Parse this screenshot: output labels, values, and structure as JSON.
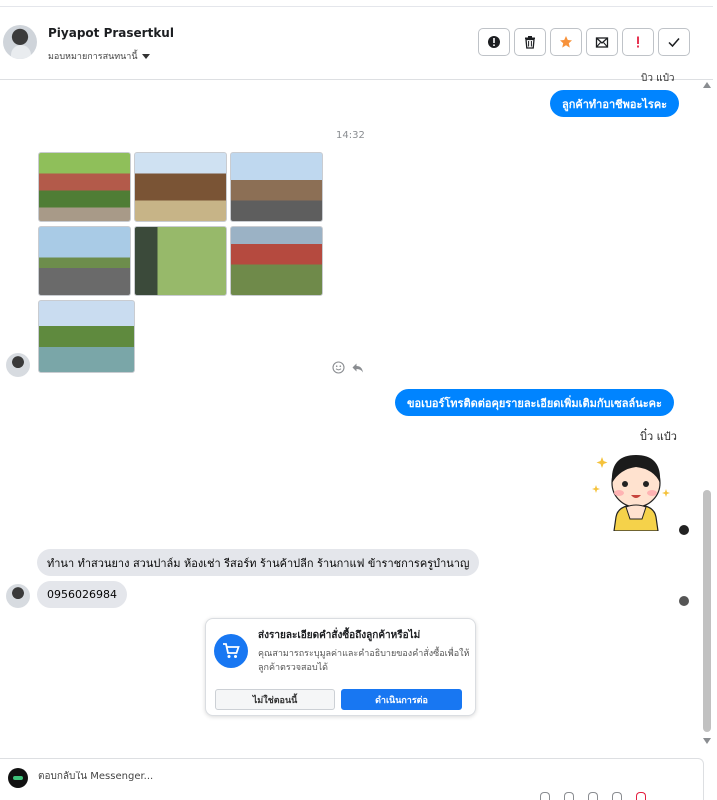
{
  "header": {
    "contact_name": "Piyapot Prasertkul",
    "assign_label": "มอบหมายการสนทนานี้",
    "actions": [
      {
        "icon": "alert-circle-icon",
        "color": "#1c1e21"
      },
      {
        "icon": "trash-icon",
        "color": "#1c1e21"
      },
      {
        "icon": "star-icon",
        "color": "#f7923b"
      },
      {
        "icon": "mark-unread-icon",
        "color": "#1c1e21"
      },
      {
        "icon": "exclamation-icon",
        "color": "#e41e3f"
      },
      {
        "icon": "check-icon",
        "color": "#1c1e21"
      }
    ]
  },
  "messages": {
    "top_sender_cut": "บิว แป๋ว",
    "out_1": "ลูกค้าทำอาชีพอะไรคะ",
    "timestamp": "14:32",
    "photo_count": 7,
    "out_2": "ขอเบอร์โทรติดต่อคุยรายละเอียดเพิ่มเติมกับเซลล์นะคะ",
    "sender_label": "บิ๋ว แป๋ว",
    "in_1": "ทำนา ทำสวนยาง สวนปาล์ม ห้องเช่า รีสอร์ท  ร้านค้าปลีก ร้านกาแฟ  ข้าราชการครูบำนาญ",
    "in_2": "0956026984"
  },
  "order_prompt": {
    "title": "ส่งรายละเอียดคำสั่งซื้อถึงลูกค้าหรือไม่",
    "description": "คุณสามารถระบุมูลค่าและคำอธิบายของคำสั่งซื้อเพื่อให้ลูกค้าตรวจสอบได้",
    "decline_label": "ไม่ใช่ตอนนี้",
    "continue_label": "ดำเนินการต่อ"
  },
  "composer": {
    "placeholder": "ตอบกลับใน Messenger..."
  },
  "colors": {
    "accent": "#0084ff",
    "incoming_bubble": "#e4e6eb",
    "star": "#f7923b",
    "alert": "#e41e3f"
  }
}
